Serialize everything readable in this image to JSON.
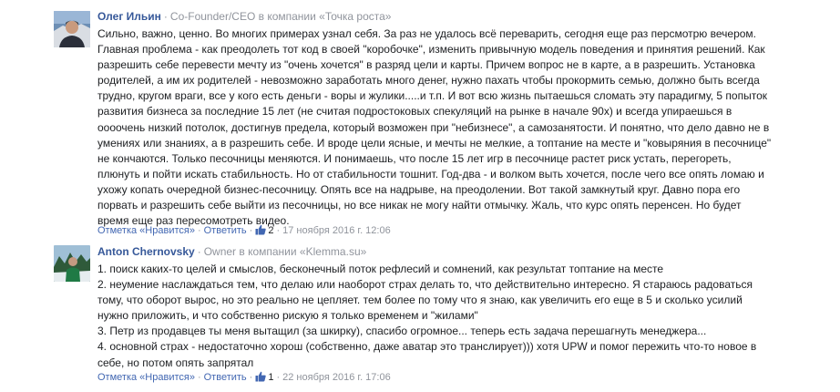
{
  "comments": [
    {
      "author": "Олег Ильин",
      "role": "Co-Founder/CEO в компании «Точка роста»",
      "text": "Сильно, важно, ценно. Во многих примерах узнал себя. За раз не удалось всё переварить, сегодня еще раз персмотрю вечером.\nГлавная проблема - как преодолеть тот код в своей \"коробочке\", изменить привычную модель поведения и принятия решений. Как\nразрешить себе перевести мечту из \"очень хочется\" в разряд цели и карты. Причем вопрос не в карте, а в разрешить. Установка\nродителей, а им их родителей - невозможно заработать много денег, нужно пахать чтобы прокормить семью, должно быть всегда\nтрудно, кругом враги, все у кого есть деньги - воры и жулики.....и т.п. И вот всю жизнь пытаешься сломать эту парадигму, 5 попыток\nразвития бизнеса за последние 15 лет (не считая подростоковых спекуляций на рынке в начале 90х) и всегда упираешься в\nоооочень низкий потолок, достигнув предела, который возможен при \"небизнесе\", а самозанятости. И понятно, что дело давно не в\nумениях или знаниях, а в разрешить себе. И вроде цели ясные, и мечты не мелкие, а топтание на месте и \"ковыряния в песочнице\"\nне кончаются. Только песочницы меняются. И понимаешь, что после 15 лет игр в песочнице растет риск устать, перегореть,\nплюнуть и пойти искать стабильность. Но от стабильности тошнит. Год-два - и волком выть хочется, после чего все опять ломаю и\nухожу копать очередной бизнес-песочницу. Опять все на надрыве, на преодолении. Вот такой замкнутый круг. Давно пора его\nпорвать и разрешить себе выйти из песочницы, но все никак не могу найти отмычку. Жаль, что курс опять перенсен. Но будет\nвремя еще раз пересомотреть видео.",
      "mark_label": "Отметка «Нравится»",
      "reply_label": "Ответить",
      "likes": "2",
      "date": "17 ноября 2016 г. 12:06"
    },
    {
      "author": "Anton Chernovsky",
      "role": "Owner в компании «Klemma.su»",
      "text": "1. поиск каких-то целей и смыслов, бесконечный поток рефлесий и сомнений, как результат топтание на месте\n2. неумение наслаждаться тем, что делаю или наоборот страх делать то, что действительно интересно. Я стараюсь радоваться\nтому, что оборот вырос, но это реально не цепляет. тем более по тому что я знаю, как увеличить его еще в 5 и сколько усилий\nнужно приложить, и что собственно рискую я только временем и \"жилами\"\n3. Петр из продавцев ты меня вытащил (за шкирку), спасибо огромное... теперь есть задача перешагнуть менеджера...\n4. основной страх - недостаточно хорош (собственно, даже аватар это транслирует))) хотя UPW и помог пережить что-то новое в\nсебе, но потом опять запрятал",
      "mark_label": "Отметка «Нравится»",
      "reply_label": "Ответить",
      "likes": "1",
      "date": "22 ноября 2016 г. 17:06"
    }
  ],
  "colors": {
    "link": "#365899",
    "meta_link": "#4267b2",
    "muted": "#90949c",
    "text": "#1c1e21"
  },
  "icons": {
    "like": "thumbs-up-icon"
  }
}
